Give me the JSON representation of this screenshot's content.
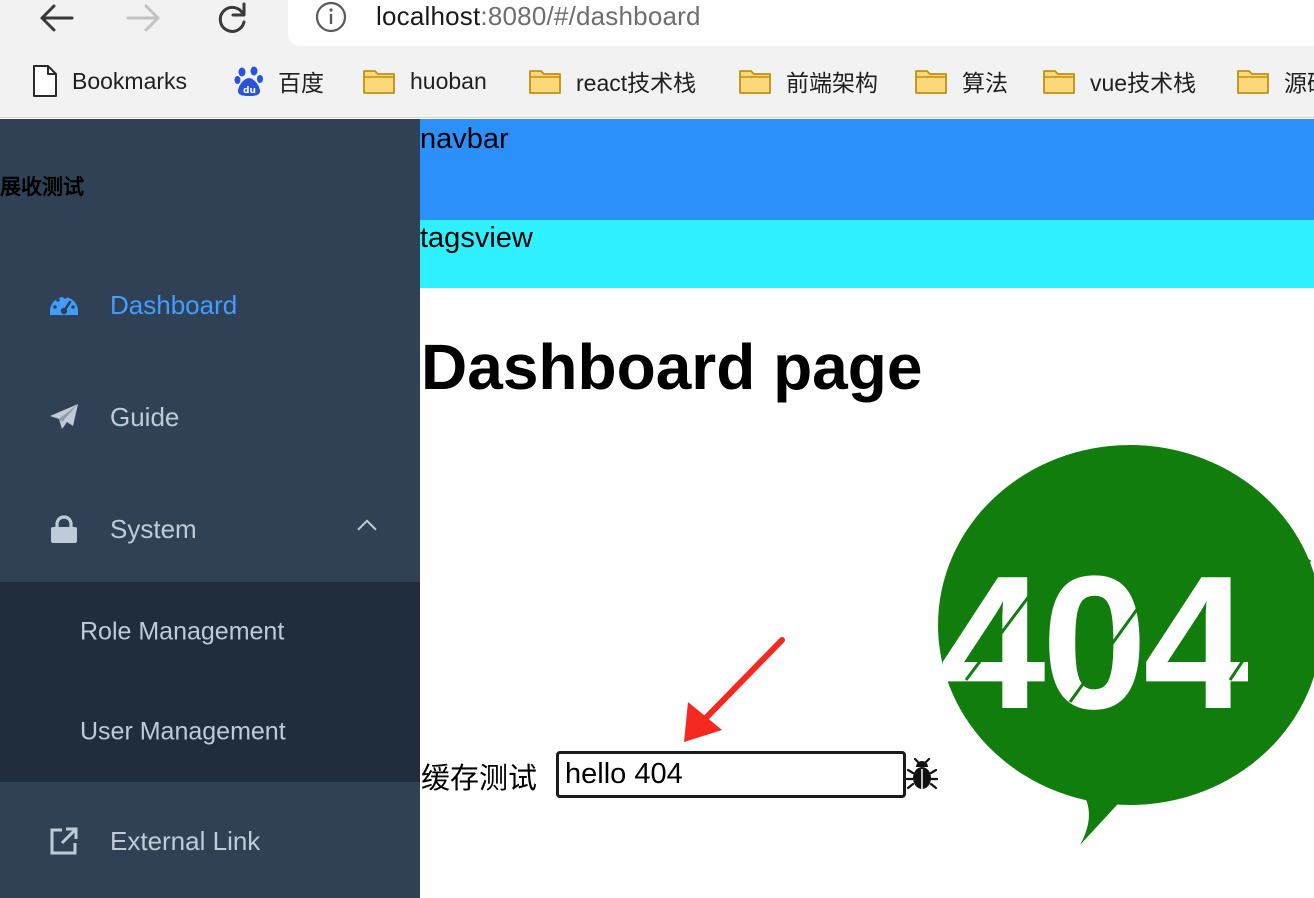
{
  "browser": {
    "url_host": "localhost",
    "url_rest": ":8080/#/dashboard",
    "bookmarks": [
      {
        "label": "Bookmarks",
        "icon": "page-icon"
      },
      {
        "label": "百度",
        "icon": "baidu-icon"
      },
      {
        "label": "huoban",
        "icon": "folder-icon"
      },
      {
        "label": "react技术栈",
        "icon": "folder-icon"
      },
      {
        "label": "前端架构",
        "icon": "folder-icon"
      },
      {
        "label": "算法",
        "icon": "folder-icon"
      },
      {
        "label": "vue技术栈",
        "icon": "folder-icon"
      },
      {
        "label": "源码",
        "icon": "folder-icon"
      }
    ]
  },
  "sidebar": {
    "brand": "展收测试",
    "items": [
      {
        "label": "Dashboard",
        "icon": "dashboard-icon",
        "active": true
      },
      {
        "label": "Guide",
        "icon": "paper-plane-icon"
      },
      {
        "label": "System",
        "icon": "lock-icon",
        "expanded": true
      },
      {
        "label": "External Link",
        "icon": "external-link-icon"
      }
    ],
    "submenu": [
      {
        "label": "Role Management"
      },
      {
        "label": "User Management"
      }
    ]
  },
  "main": {
    "navbar": "navbar",
    "tagsview": "tagsview",
    "title": "Dashboard page",
    "logo_text": "404",
    "cache_label": "缓存测试",
    "cache_value": "hello 404"
  },
  "colors": {
    "sidebar_bg": "#304156",
    "submenu_bg": "#1f2d3d",
    "active": "#409eff",
    "navbar_bg": "#2b90fa",
    "tagsview_bg": "#2ef0fe",
    "logo_green": "#117d0d",
    "arrow_red": "#f5291f"
  }
}
